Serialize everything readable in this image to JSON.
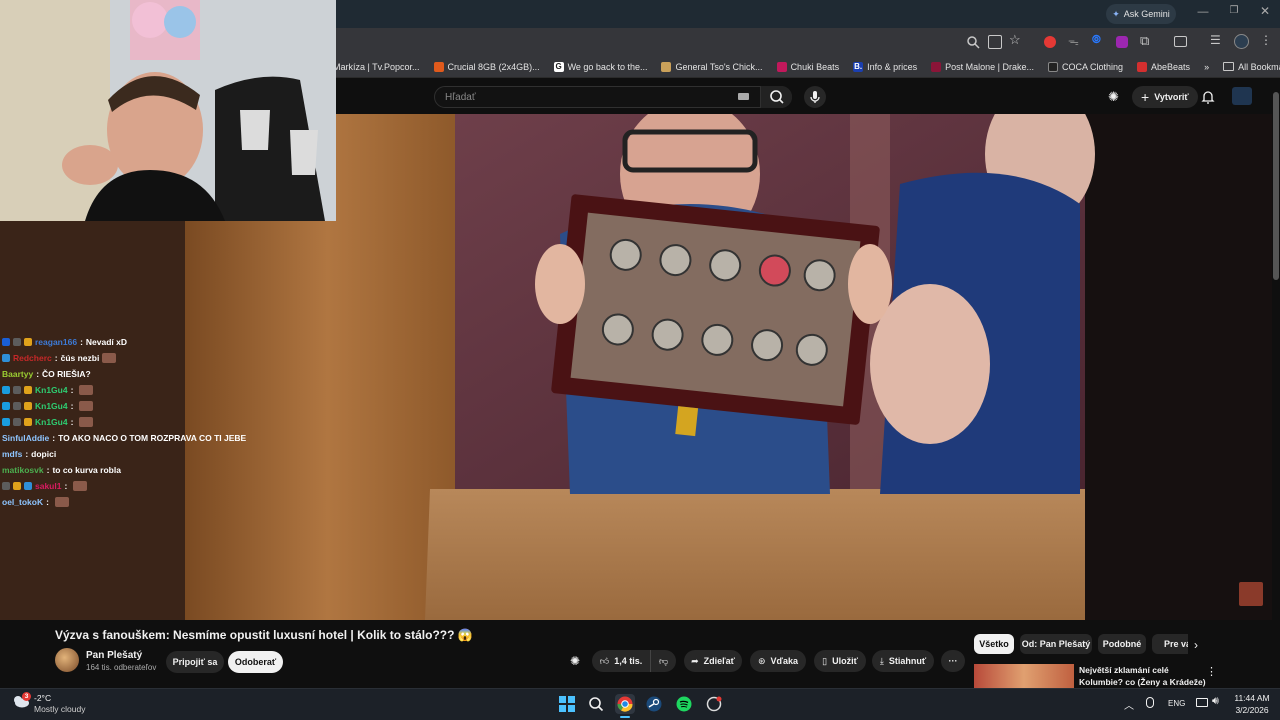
{
  "browser": {
    "ask_gemini": "Ask Gemini",
    "bookmarks": [
      {
        "label": "Markíza | Tv.Popcor...",
        "color": "#3a3a3a"
      },
      {
        "label": "Crucial 8GB (2x4GB)...",
        "color": "#e05a1c"
      },
      {
        "label": "We go back to the...",
        "color": "#2b2b2b"
      },
      {
        "label": "General Tso's Chick...",
        "color": "#caa15a"
      },
      {
        "label": "Chuki Beats",
        "color": "#c2185b"
      },
      {
        "label": "Info & prices",
        "color": "#1b3fb0"
      },
      {
        "label": "Post Malone | Drake...",
        "color": "#8a1538"
      },
      {
        "label": "COCA Clothing",
        "color": "#222222"
      },
      {
        "label": "AbeBeats",
        "color": "#d32f2f"
      }
    ],
    "all_bookmarks": "All Bookmarks",
    "bookmarks_overflow": "»"
  },
  "youtube": {
    "search_placeholder": "Hľadať",
    "create_label": "Vytvoriť"
  },
  "chat": [
    {
      "user": "reagan166",
      "user_color": "#3d7ad6",
      "message": "Nevadí xD",
      "badges": [
        "#1a5fd6",
        "#5c5c5c",
        "#e0a21b"
      ]
    },
    {
      "user": "Redcherc",
      "user_color": "#c62828",
      "message": "čús nezbi",
      "badges": [
        "#2f8fd8"
      ],
      "emote": true
    },
    {
      "user": "Baartyy",
      "user_color": "#9acd32",
      "message": "ČO RIEŠIA?",
      "badges": []
    },
    {
      "user": "Kn1Gu4",
      "user_color": "#2ecc71",
      "message": "",
      "badges": [
        "#1a9de0",
        "#5c5c5c",
        "#e0a21b"
      ],
      "emote": true
    },
    {
      "user": "Kn1Gu4",
      "user_color": "#2ecc71",
      "message": "",
      "badges": [
        "#1a9de0",
        "#5c5c5c",
        "#e0a21b"
      ],
      "emote": true
    },
    {
      "user": "Kn1Gu4",
      "user_color": "#2ecc71",
      "message": "",
      "badges": [
        "#1a9de0",
        "#5c5c5c",
        "#e0a21b"
      ],
      "emote": true
    },
    {
      "user": "SinfulAddie",
      "user_color": "#8ec5ff",
      "message": "TO AKO NACO O TOM ROZPRAVA CO TI JEBE",
      "badges": []
    },
    {
      "user": "mdfs",
      "user_color": "#8ec5ff",
      "message": "dopici",
      "badges": []
    },
    {
      "user": "matikosvk",
      "user_color": "#4caf50",
      "message": "to co kurva robla",
      "badges": []
    },
    {
      "user": "sakul1",
      "user_color": "#d81b60",
      "message": "",
      "badges": [
        "#5c5c5c",
        "#e0a21b",
        "#2f8fd8"
      ],
      "emote": true
    },
    {
      "user": "oel_tokoK",
      "user_color": "#8ec5ff",
      "message": "",
      "badges": [],
      "emote": true
    }
  ],
  "video": {
    "title": "Výzva s fanouškem: Nesmíme opustit luxusní hotel | Kolik to stálo??? 😱",
    "channel_name": "Pan Plešatý",
    "subscribers": "164 tis. odberateľov",
    "join_label": "Pripojiť sa",
    "subscribe_label": "Odoberať",
    "like_count": "1,4 tis.",
    "share_label": "Zdieľať",
    "thanks_label": "Vďaka",
    "save_label": "Uložiť",
    "download_label": "Stiahnuť",
    "more_label": "···"
  },
  "related": {
    "chips": [
      "Všetko",
      "Od: Pan Plešatý",
      "Podobné",
      "Pre vás"
    ],
    "next_title_line1": "Největší zklamání celé",
    "next_title_line2": "Kolumbie? co (Ženy a Krádeže)"
  },
  "taskbar": {
    "temperature": "-2°C",
    "weather": "Mostly cloudy",
    "notification_count": "3",
    "language": "ENG",
    "time": "11:44 AM",
    "date": "3/2/2026"
  }
}
